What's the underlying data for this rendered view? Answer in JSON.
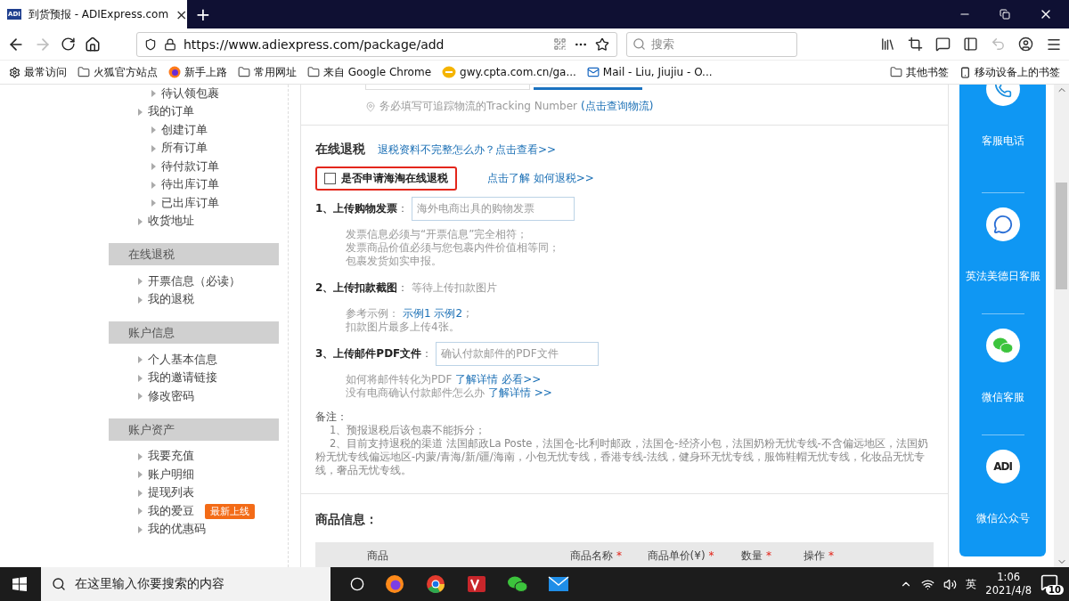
{
  "browser": {
    "tab": {
      "logo": "ADI",
      "title": "到货预报 - ADIExpress.com",
      "close": "×"
    },
    "new_tab": "+",
    "url": "https://www.adiexpress.com/package/add",
    "search_placeholder": "搜索",
    "bookmarks": [
      {
        "label": "最常访问",
        "kind": "gear"
      },
      {
        "label": "火狐官方站点",
        "kind": "folder"
      },
      {
        "label": "新手上路",
        "kind": "firefox"
      },
      {
        "label": "常用网址",
        "kind": "folder"
      },
      {
        "label": "来自 Google Chrome",
        "kind": "folder"
      },
      {
        "label": "gwy.cpta.com.cn/ga...",
        "kind": "site"
      },
      {
        "label": "Mail - Liu, Jiujiu - O...",
        "kind": "mail"
      }
    ],
    "bookmarks_right": [
      {
        "label": "其他书签",
        "kind": "folder"
      },
      {
        "label": "移动设备上的书签",
        "kind": "phone"
      }
    ]
  },
  "sidebar": {
    "groups": [
      {
        "items": [
          {
            "children": [
              {
                "label": "待认领包裹"
              }
            ]
          },
          {
            "label": "我的订单",
            "children": [
              {
                "label": "创建订单"
              },
              {
                "label": "所有订单"
              },
              {
                "label": "待付款订单"
              },
              {
                "label": "待出库订单"
              },
              {
                "label": "已出库订单"
              }
            ]
          },
          {
            "label": "收货地址"
          }
        ]
      },
      {
        "title": "在线退税",
        "items": [
          {
            "label": "开票信息（必读）"
          },
          {
            "label": "我的退税"
          }
        ]
      },
      {
        "title": "账户信息",
        "items": [
          {
            "label": "个人基本信息"
          },
          {
            "label": "我的邀请链接"
          },
          {
            "label": "修改密码"
          }
        ]
      },
      {
        "title": "账户资产",
        "items": [
          {
            "label": "我要充值"
          },
          {
            "label": "账户明细"
          },
          {
            "label": "提现列表"
          },
          {
            "label": "我的爱豆",
            "badge": "最新上线"
          },
          {
            "label": "我的优惠码"
          }
        ]
      }
    ]
  },
  "tracking": {
    "hint": "务必填写可追踪物流的Tracking Number",
    "link": "(点击查询物流)"
  },
  "tax": {
    "title": "在线退税",
    "help_link": "退税资料不完整怎么办？点击查看>>",
    "checkbox": {
      "label": "是否申请海淘在线退税",
      "checked": false
    },
    "how_link": "点击了解 如何退税>>",
    "steps": [
      {
        "kind": "input",
        "label": "1、上传购物发票",
        "colon": "：",
        "placeholder": "海外电商出具的购物发票",
        "notes": [
          [
            {
              "text": "发票信息必须与“开票信息”完全相符；"
            }
          ],
          [
            {
              "text": "发票商品价值必须与您包裹内件价值相等同；"
            }
          ],
          [
            {
              "text": "包裹发货如实申报。"
            }
          ]
        ]
      },
      {
        "kind": "status",
        "label": "2、上传扣款截图",
        "colon": "：",
        "status": "等待上传扣款图片",
        "notes": [
          [
            {
              "text": "参考示例："
            },
            {
              "text": "示例1 示例2",
              "link": true
            },
            {
              "text": ";"
            }
          ],
          [
            {
              "text": "扣款图片最多上传4张。"
            }
          ]
        ]
      },
      {
        "kind": "input",
        "label": "3、上传邮件PDF文件",
        "colon": "：",
        "placeholder": "确认付款邮件的PDF文件",
        "notes": [
          [
            {
              "text": "如何将邮件转化为PDF"
            },
            {
              "text": "了解详情 必看>>",
              "link": true
            }
          ],
          [
            {
              "text": "没有电商确认付款邮件怎么办"
            },
            {
              "text": "了解详情 >>",
              "link": true
            }
          ]
        ]
      }
    ],
    "remarks_title": "备注：",
    "remarks": [
      "1、预报退税后该包裹不能拆分；",
      "2、目前支持退税的渠道 法国邮政La Poste，法国仓-比利时邮政，法国仓-经济小包，法国奶粉无忧专线-不含偏远地区，法国奶粉无忧专线偏远地区-内蒙/青海/新/疆/海南，小包无忧专线，香港专线-法线，健身环无忧专线，服饰鞋帽无忧专线，化妆品无忧专线，奢品无忧专线。"
    ]
  },
  "goods": {
    "title": "商品信息：",
    "required_mark": "*",
    "columns": [
      {
        "label": "商品",
        "required": false
      },
      {
        "label": "商品名称",
        "required": true
      },
      {
        "label": "商品单价(¥)",
        "required": true
      },
      {
        "label": "数量",
        "required": true
      },
      {
        "label": "操作",
        "required": true
      }
    ]
  },
  "service_panel": [
    {
      "kind": "phone",
      "label": "客服电话"
    },
    {
      "kind": "chat",
      "label": "英法美德日客服"
    },
    {
      "kind": "wechat",
      "label": "微信客服"
    },
    {
      "kind": "logo",
      "logo": "ADI",
      "label": "微信公众号"
    }
  ],
  "taskbar": {
    "search_placeholder": "在这里输入你要搜索的内容",
    "ime": "英",
    "time": "1:06",
    "date": "2021/4/8",
    "notifications": "10"
  }
}
